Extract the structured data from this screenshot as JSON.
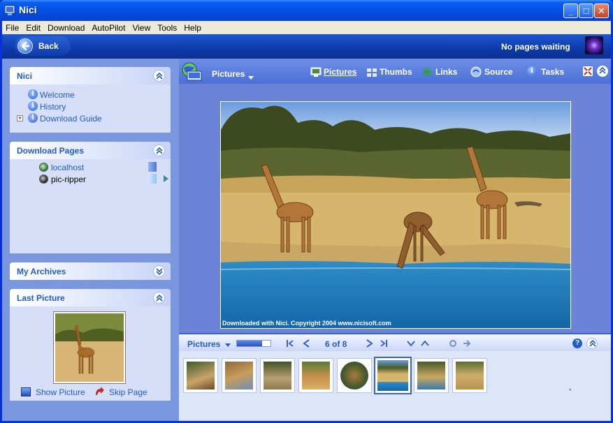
{
  "window": {
    "title": "Nici"
  },
  "menu": [
    "File",
    "Edit",
    "Download",
    "AutoPilot",
    "View",
    "Tools",
    "Help"
  ],
  "navbar": {
    "back_label": "Back",
    "status": "No pages waiting"
  },
  "left": {
    "nici": {
      "title": "Nici",
      "items": [
        "Welcome",
        "History",
        "Download Guide"
      ]
    },
    "download_pages": {
      "title": "Download Pages",
      "items": [
        "localhost",
        "pic-ripper"
      ]
    },
    "archives": {
      "title": "My Archives"
    },
    "last_picture": {
      "title": "Last Picture",
      "show_label": "Show Picture",
      "skip_label": "Skip Page"
    }
  },
  "toolbar": {
    "section_title": "Pictures",
    "tabs": [
      "Pictures",
      "Thumbs",
      "Links",
      "Source",
      "Tasks"
    ],
    "active_tab": "Pictures"
  },
  "viewer": {
    "caption": "Downloaded with Nici. Copyright 2004 www.nicisoft.com"
  },
  "strip": {
    "title": "Pictures",
    "counter": "6 of 8",
    "progress": 0.75,
    "selected_index": 5,
    "thumb_count": 8,
    "selected_mark": "*"
  }
}
